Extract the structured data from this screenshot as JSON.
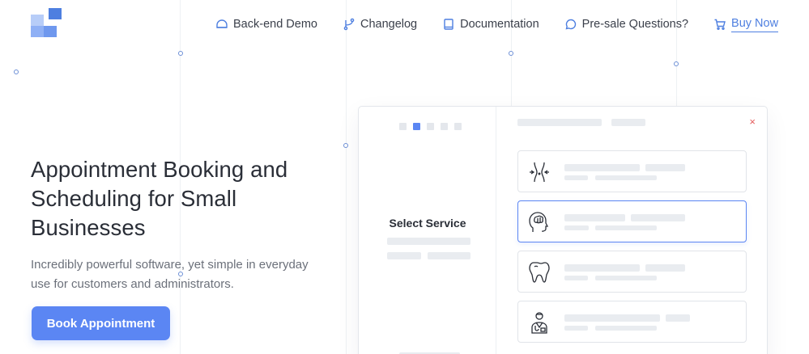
{
  "brand": {
    "logo_name": "booking-app-logo",
    "accent": "#5b86f3",
    "logo_colors": [
      "#4e7fe0",
      "#8fb0f5",
      "#b7cdf8"
    ]
  },
  "nav": {
    "items": [
      {
        "label": "Back-end Demo",
        "icon": "dashboard-icon"
      },
      {
        "label": "Changelog",
        "icon": "branch-icon"
      },
      {
        "label": "Documentation",
        "icon": "book-icon"
      },
      {
        "label": "Pre-sale Questions?",
        "icon": "chat-icon"
      },
      {
        "label": "Buy Now",
        "icon": "cart-icon"
      }
    ]
  },
  "hero": {
    "title": "Appointment Booking and Scheduling for Small Businesses",
    "subtitle": "Incredibly powerful software, yet simple in everyday use for customers and administrators.",
    "cta_label": "Book Appointment"
  },
  "mock": {
    "step_count": 5,
    "active_step": 2,
    "select_service_label": "Select Service",
    "close_glyph": "×",
    "services": [
      {
        "icon": "waist-icon",
        "selected": false
      },
      {
        "icon": "brain-icon",
        "selected": true
      },
      {
        "icon": "tooth-icon",
        "selected": false
      },
      {
        "icon": "doctor-icon",
        "selected": false
      }
    ]
  }
}
